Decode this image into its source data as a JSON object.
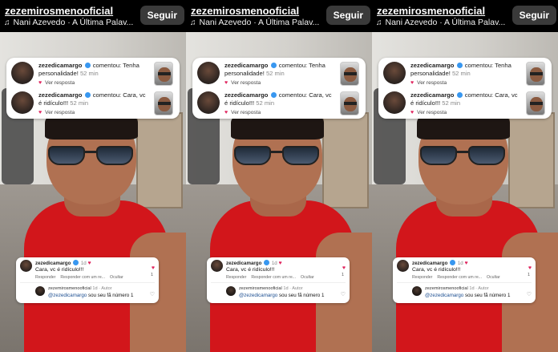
{
  "header": {
    "username": "zezemirosmenooficial",
    "audio": "Nani Azevedo · A Última Palav...",
    "follow_label": "Seguir"
  },
  "top_comments": [
    {
      "user": "zezedicamargo",
      "verb": "comentou:",
      "text": "Tenha personalidade!",
      "time": "52 min",
      "reply_label": "Ver resposta"
    },
    {
      "user": "zezedicamargo",
      "verb": "comentou:",
      "text": "Cara, vc é ridículo!!!",
      "time": "52 min",
      "reply_label": "Ver resposta"
    }
  ],
  "bottom_comment": {
    "user": "zezedicamargo",
    "time": "1d",
    "text": "Cara, vc é ridículo!!!",
    "like_count": "1",
    "actions": [
      "Responder",
      "Responder com um re...",
      "Ocultar"
    ],
    "reply": {
      "user": "zezemirosmenooficial",
      "meta": "1d · Autor",
      "mention": "@zezedicamargo",
      "text": "sou seu fã número 1"
    }
  },
  "colors": {
    "follow_bg": "#3a3a3a",
    "shirt": "#d2161b",
    "like": "#e0245e",
    "verified": "#3897f0"
  }
}
